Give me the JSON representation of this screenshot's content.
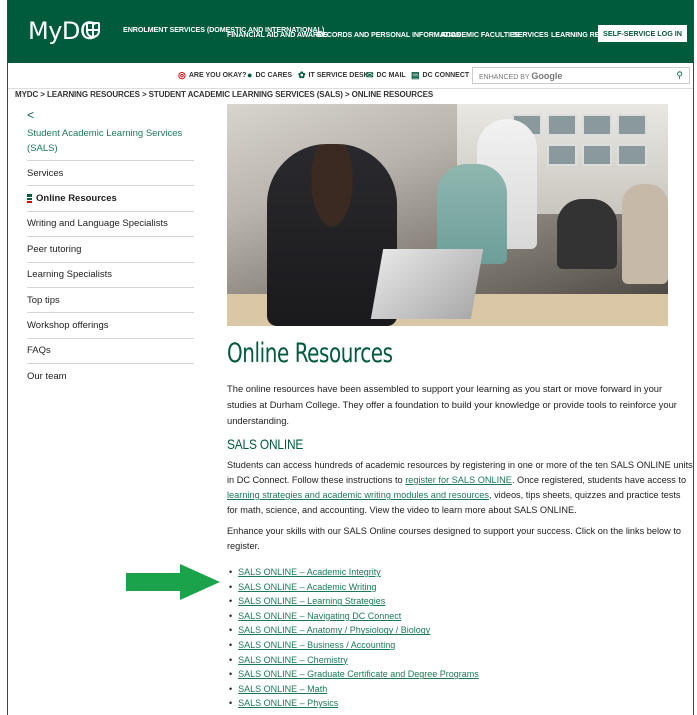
{
  "header": {
    "logo": "MyDC",
    "nav": [
      {
        "label": "Enrolment Services (Domestic and International)"
      },
      {
        "label": "Financial Aid and Awards"
      },
      {
        "label": "Records and Personal Information"
      },
      {
        "label": "Academic Faculties"
      },
      {
        "label": "Services"
      },
      {
        "label": "Learning Resources"
      }
    ],
    "login": "Self-Service Log In",
    "brand_color": "#005a3c"
  },
  "utility": {
    "items": [
      {
        "label": "Are you okay?",
        "icon": "lifebuoy-icon"
      },
      {
        "label": "DC Cares",
        "icon": "speech-bubble-icon"
      },
      {
        "label": "IT Service Desk",
        "icon": "gear-icon"
      },
      {
        "label": "DC Mail",
        "icon": "envelope-icon"
      },
      {
        "label": "DC Connect",
        "icon": "connect-icon"
      }
    ],
    "search_prefix": "ENHANCED BY",
    "search_brand": "Google"
  },
  "breadcrumb": "MYDC > LEARNING RESOURCES > STUDENT ACADEMIC LEARNING SERVICES (SALS) > ONLINE RESOURCES",
  "sidebar": {
    "back": "<",
    "title": "Student Academic Learning Services (SALS)",
    "items": [
      {
        "label": "Services"
      },
      {
        "label": "Online Resources"
      },
      {
        "label": "Writing and Language Specialists"
      },
      {
        "label": "Peer tutoring"
      },
      {
        "label": "Learning Specialists"
      },
      {
        "label": "Top tips"
      },
      {
        "label": "Workshop offerings"
      },
      {
        "label": "FAQs"
      },
      {
        "label": "Our team"
      }
    ]
  },
  "main": {
    "title": "Online Resources",
    "intro": "The online resources have been assembled to support your learning as you start or move forward in your studies at Durham College. They offer a foundation to build your knowledge or provide tools to reinforce your understanding.",
    "section_title": "SALS ONLINE",
    "p1_a": "Students can access hundreds of academic resources by registering in one or more of the ten SALS ONLINE units in DC Connect. Follow these instructions to ",
    "p1_link1": "register for SALS ONLINE",
    "p1_b": ". Once registered, students have access to ",
    "p1_link2": "learning strategies and academic writing modules and resources",
    "p1_c": ", videos, tips sheets, quizzes and practice tests for math, science, and accounting. View the video to learn more about SALS ONLINE.",
    "p2": "Enhance your skills with our SALS Online courses designed to support your success. Click on the links below to register.",
    "links": [
      "SALS ONLINE – Academic Integrity",
      "SALS ONLINE – Academic Writing",
      "SALS ONLINE – Learning Strategies",
      "SALS ONLINE – Navigating DC Connect",
      "SALS ONLINE – Anatomy / Physiology / Biology",
      "SALS ONLINE – Business / Accounting",
      "SALS ONLINE – Chemistry",
      "SALS ONLINE – Graduate Certificate and Degree Programs",
      "SALS ONLINE – Math",
      "SALS ONLINE – Physics"
    ],
    "arrow_color": "#1aa34a"
  }
}
